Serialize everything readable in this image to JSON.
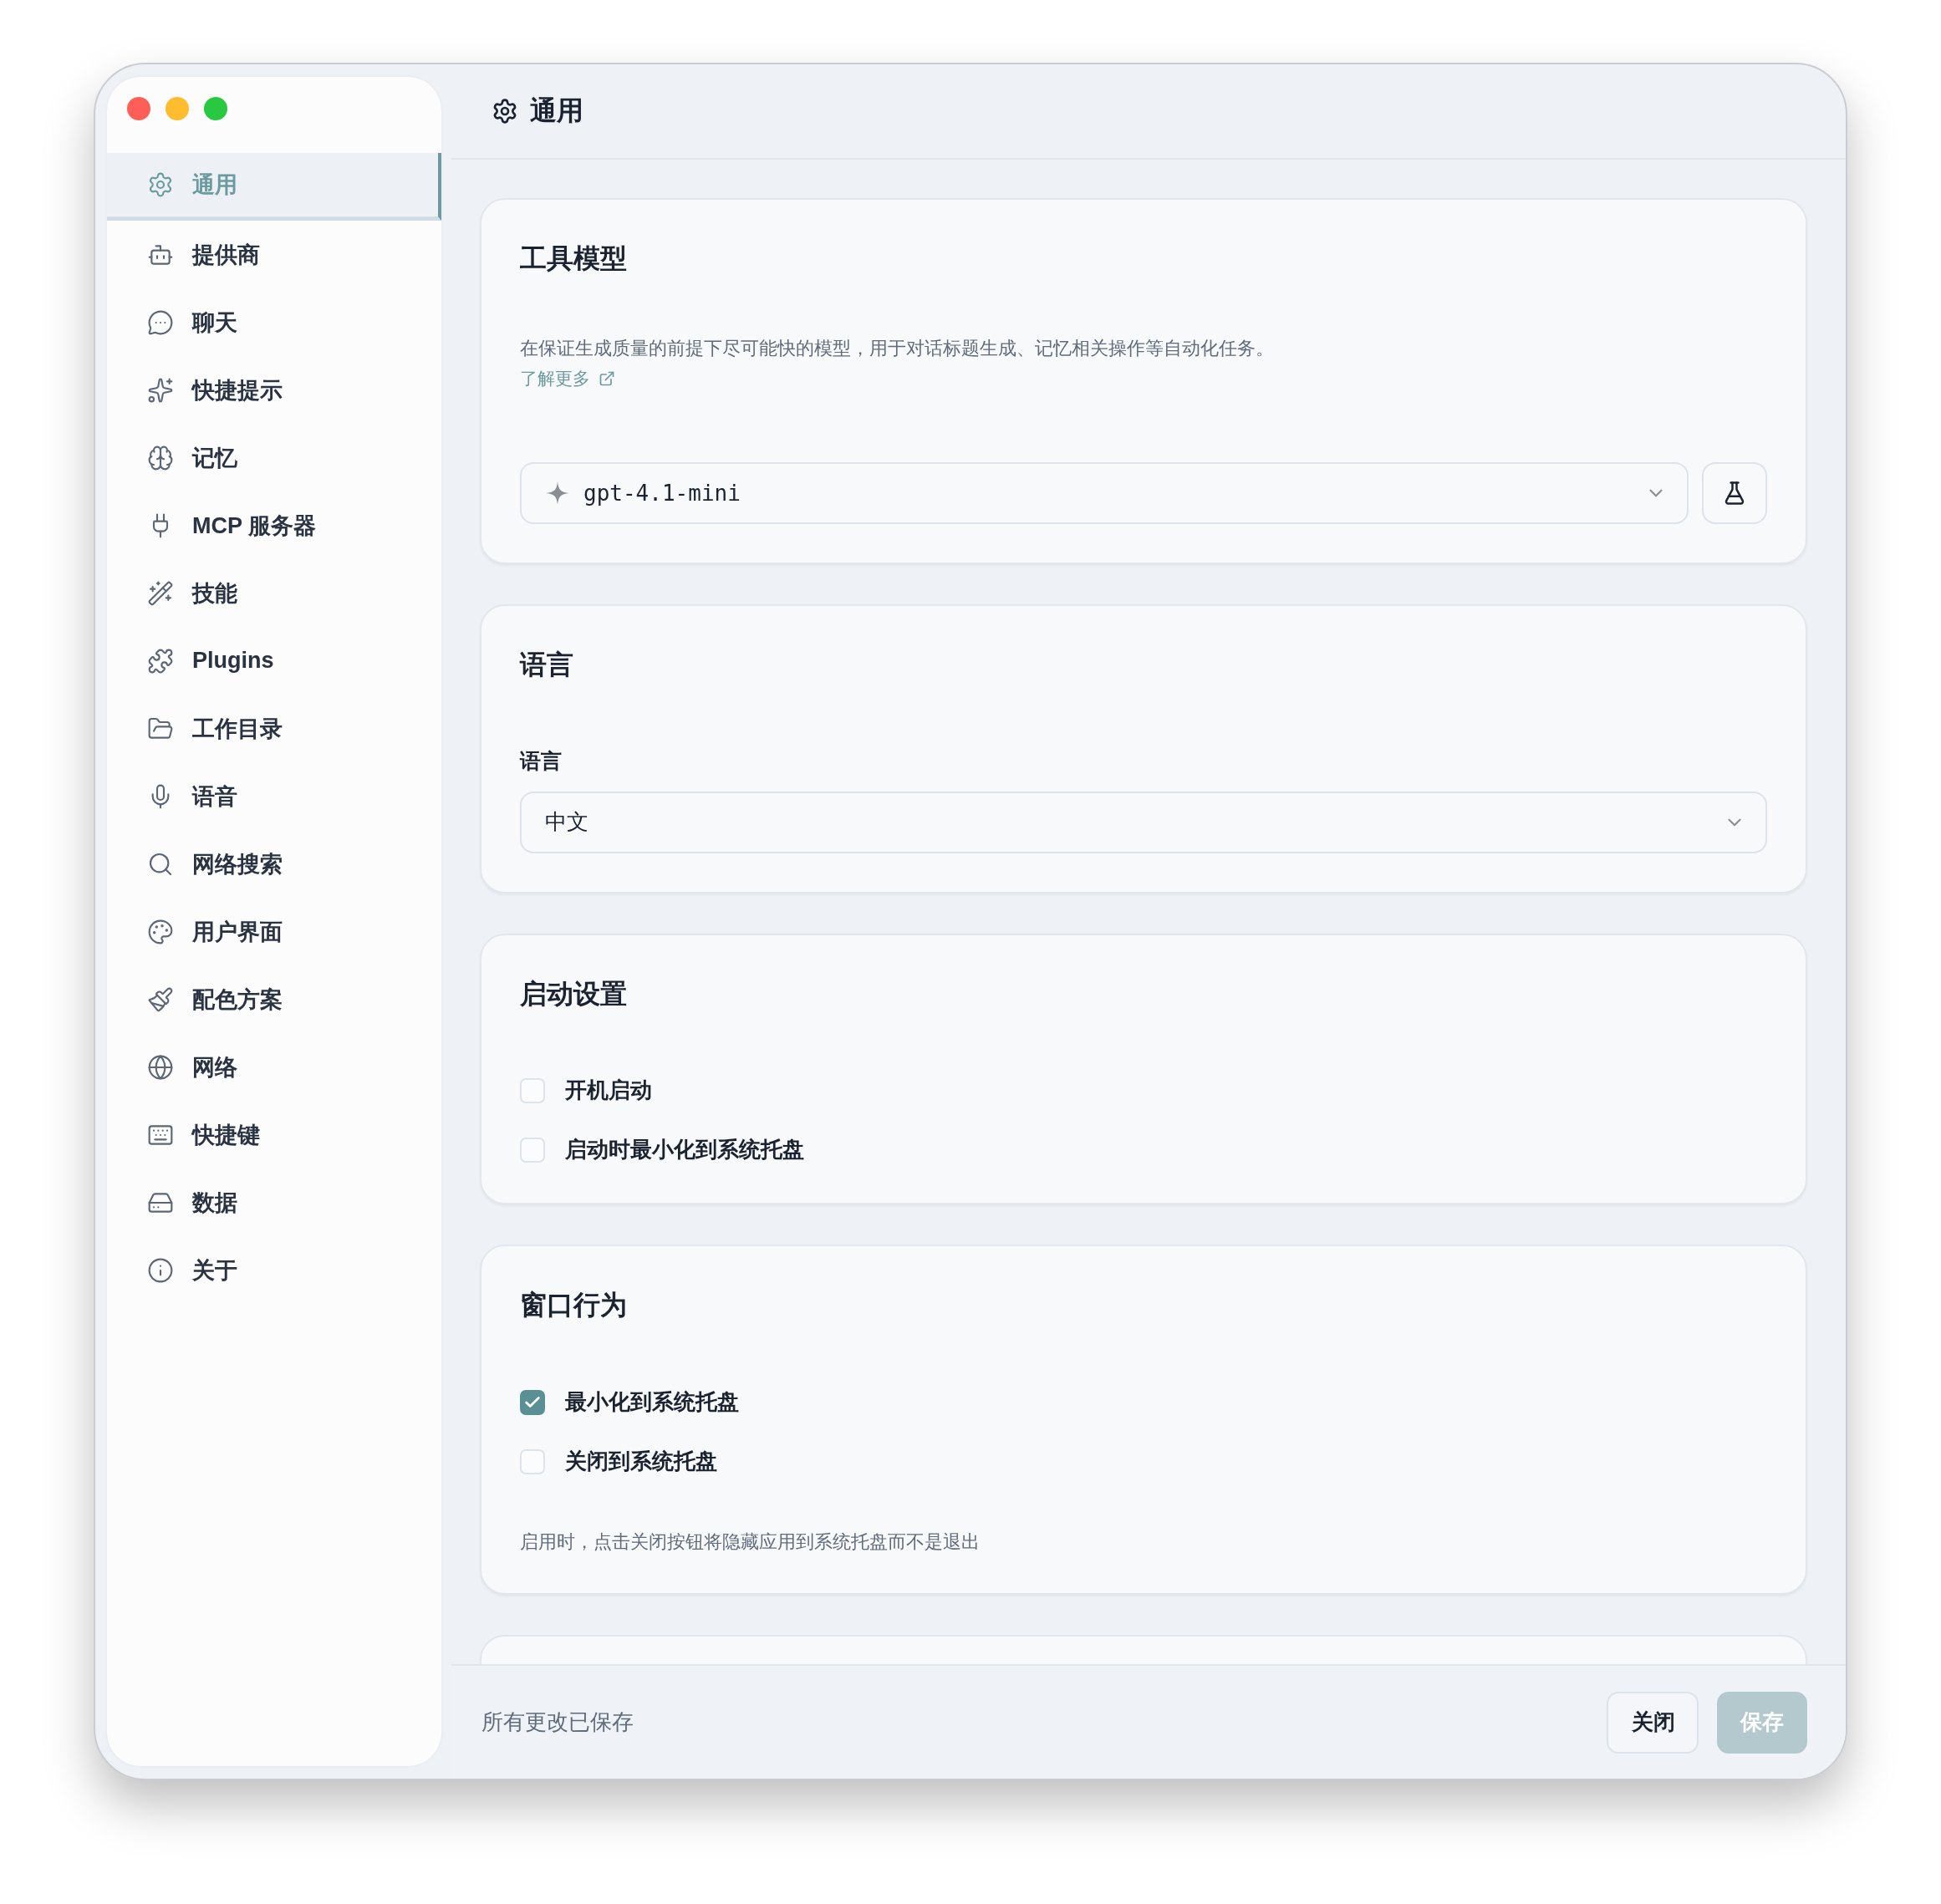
{
  "sidebar": {
    "items": [
      {
        "label": "通用",
        "kind": "general",
        "selected": true
      },
      {
        "label": "提供商",
        "kind": "provider",
        "selected": false
      },
      {
        "label": "聊天",
        "kind": "chat",
        "selected": false
      },
      {
        "label": "快捷提示",
        "kind": "prompts",
        "selected": false
      },
      {
        "label": "记忆",
        "kind": "memory",
        "selected": false
      },
      {
        "label": "MCP 服务器",
        "kind": "mcp",
        "selected": false
      },
      {
        "label": "技能",
        "kind": "skills",
        "selected": false
      },
      {
        "label": "Plugins",
        "kind": "plugins",
        "selected": false
      },
      {
        "label": "工作目录",
        "kind": "folder",
        "selected": false
      },
      {
        "label": "语音",
        "kind": "voice",
        "selected": false
      },
      {
        "label": "网络搜索",
        "kind": "search",
        "selected": false
      },
      {
        "label": "用户界面",
        "kind": "ui",
        "selected": false
      },
      {
        "label": "配色方案",
        "kind": "theme",
        "selected": false
      },
      {
        "label": "网络",
        "kind": "network",
        "selected": false
      },
      {
        "label": "快捷键",
        "kind": "shortcuts",
        "selected": false
      },
      {
        "label": "数据",
        "kind": "data",
        "selected": false
      },
      {
        "label": "关于",
        "kind": "about",
        "selected": false
      }
    ]
  },
  "header": {
    "title": "通用"
  },
  "tool_model": {
    "title": "工具模型",
    "description": "在保证生成质量的前提下尽可能快的模型，用于对话标题生成、记忆相关操作等自动化任务。",
    "link": "了解更多",
    "model": {
      "value": "gpt-4.1-mini"
    }
  },
  "language": {
    "title": "语言",
    "field_label": "语言",
    "select": {
      "value": "中文"
    }
  },
  "startup": {
    "title": "启动设置",
    "options": [
      {
        "label": "开机启动",
        "checked": false
      },
      {
        "label": "启动时最小化到系统托盘",
        "checked": false
      }
    ]
  },
  "window_behavior": {
    "title": "窗口行为",
    "options": [
      {
        "label": "最小化到系统托盘",
        "checked": true
      },
      {
        "label": "关闭到系统托盘",
        "checked": false
      }
    ],
    "note": "启用时，点击关闭按钮将隐藏应用到系统托盘而不是退出"
  },
  "footer": {
    "status": "所有更改已保存",
    "buttons": [
      {
        "label": "关闭",
        "kind": "secondary",
        "disabled": false
      },
      {
        "label": "保存",
        "kind": "primary",
        "disabled": true
      }
    ]
  }
}
